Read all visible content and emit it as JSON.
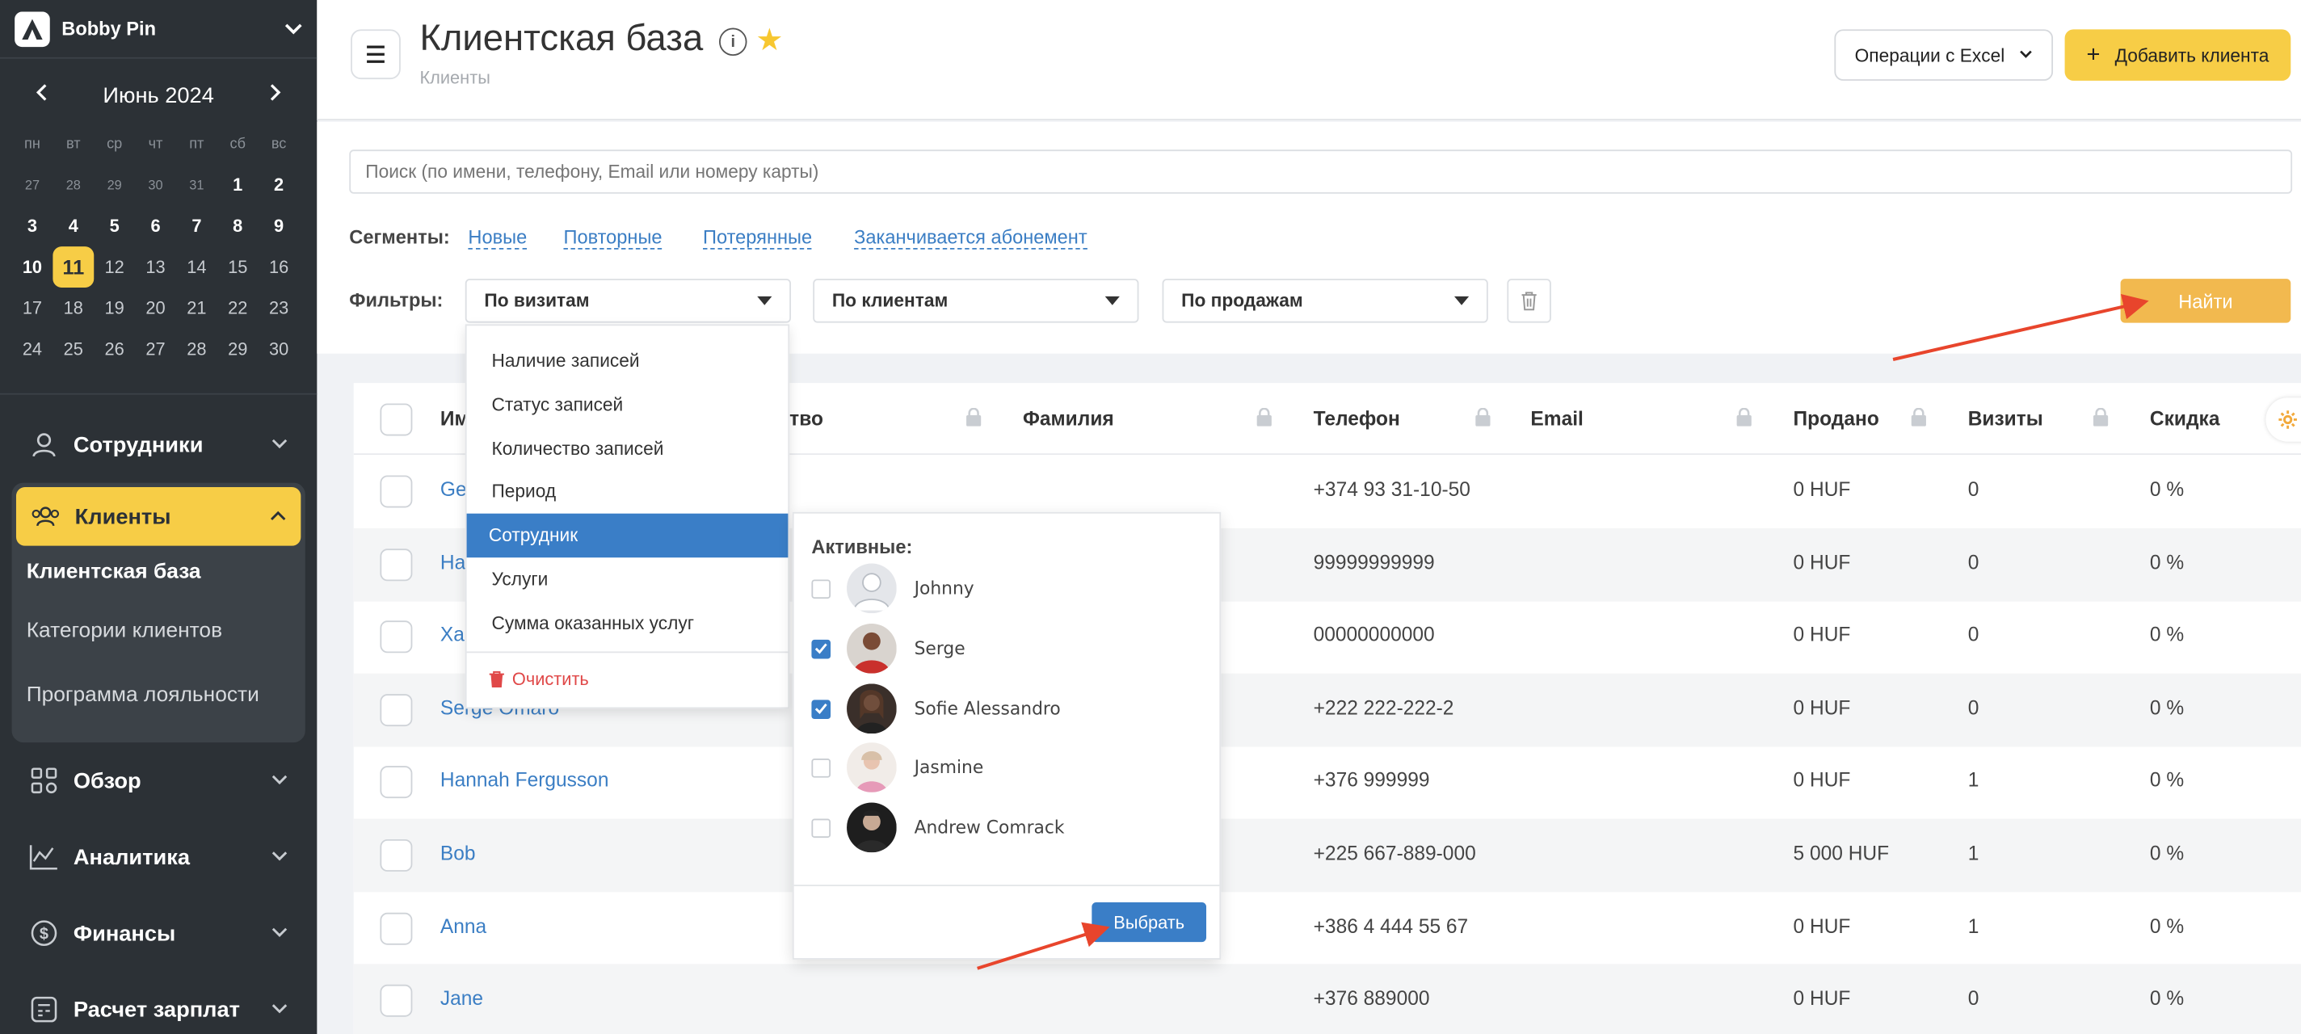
{
  "brand": {
    "name": "Bobby Pin"
  },
  "calendar": {
    "title": "Июнь 2024",
    "weekdays": [
      "пн",
      "вт",
      "ср",
      "чт",
      "пт",
      "сб",
      "вс"
    ],
    "days": [
      {
        "d": "27",
        "k": "dim"
      },
      {
        "d": "28",
        "k": "dim"
      },
      {
        "d": "29",
        "k": "dim"
      },
      {
        "d": "30",
        "k": "dim"
      },
      {
        "d": "31",
        "k": "dim"
      },
      {
        "d": "1",
        "k": "bold"
      },
      {
        "d": "2",
        "k": "bold"
      },
      {
        "d": "3",
        "k": "bold"
      },
      {
        "d": "4",
        "k": "bold"
      },
      {
        "d": "5",
        "k": "bold"
      },
      {
        "d": "6",
        "k": "bold"
      },
      {
        "d": "7",
        "k": "bold"
      },
      {
        "d": "8",
        "k": "bold"
      },
      {
        "d": "9",
        "k": "bold"
      },
      {
        "d": "10",
        "k": "bold"
      },
      {
        "d": "11",
        "k": "today"
      },
      {
        "d": "12",
        "k": "reg"
      },
      {
        "d": "13",
        "k": "reg"
      },
      {
        "d": "14",
        "k": "reg"
      },
      {
        "d": "15",
        "k": "reg"
      },
      {
        "d": "16",
        "k": "reg"
      },
      {
        "d": "17",
        "k": "reg"
      },
      {
        "d": "18",
        "k": "reg"
      },
      {
        "d": "19",
        "k": "reg"
      },
      {
        "d": "20",
        "k": "reg"
      },
      {
        "d": "21",
        "k": "reg"
      },
      {
        "d": "22",
        "k": "reg"
      },
      {
        "d": "23",
        "k": "reg"
      },
      {
        "d": "24",
        "k": "reg"
      },
      {
        "d": "25",
        "k": "reg"
      },
      {
        "d": "26",
        "k": "reg"
      },
      {
        "d": "27",
        "k": "reg"
      },
      {
        "d": "28",
        "k": "reg"
      },
      {
        "d": "29",
        "k": "reg"
      },
      {
        "d": "30",
        "k": "reg"
      }
    ]
  },
  "nav": {
    "staff": "Сотрудники",
    "clients": "Клиенты",
    "clients_sub": [
      "Клиентская база",
      "Категории клиентов",
      "Программа лояльности"
    ],
    "overview": "Обзор",
    "analytics": "Аналитика",
    "finance": "Финансы",
    "payroll": "Расчет зарплат"
  },
  "header": {
    "title": "Клиентская база",
    "breadcrumb": "Клиенты",
    "excel_label": "Операции с Excel",
    "add_label": "Добавить клиента"
  },
  "search": {
    "placeholder": "Поиск (по имени, телефону, Email или номеру карты)"
  },
  "segments": {
    "label": "Сегменты:",
    "items": [
      "Новые",
      "Повторные",
      "Потерянные",
      "Заканчивается абонемент"
    ]
  },
  "filters": {
    "label": "Фильтры:",
    "selects": [
      "По визитам",
      "По клиентам",
      "По продажам"
    ],
    "find_label": "Найти"
  },
  "dropdown": {
    "items": [
      "Наличие записей",
      "Статус записей",
      "Количество записей",
      "Период",
      "Сотрудник",
      "Услуги",
      "Сумма оказанных услуг"
    ],
    "selected_index": 4,
    "clear_label": "Очистить"
  },
  "employees": {
    "title": "Активные:",
    "items": [
      {
        "name": "Johnny",
        "checked": false
      },
      {
        "name": "Serge",
        "checked": true
      },
      {
        "name": "Sofie Alessandro",
        "checked": true
      },
      {
        "name": "Jasmine",
        "checked": false
      },
      {
        "name": "Andrew Comrack",
        "checked": false
      }
    ],
    "choose_label": "Выбрать"
  },
  "table": {
    "columns": {
      "name": "Им",
      "middlename": "тво",
      "surname": "Фамилия",
      "phone": "Телефон",
      "email": "Email",
      "sold": "Продано",
      "visits": "Визиты",
      "discount": "Скидка"
    },
    "rows": [
      {
        "name": "Ge",
        "phone": "+374 93 31-10-50",
        "sold": "0 HUF",
        "visits": "0",
        "discount": "0 %"
      },
      {
        "name": "Ha",
        "phone": "99999999999",
        "sold": "0 HUF",
        "visits": "0",
        "discount": "0 %"
      },
      {
        "name": "Xa",
        "phone": "00000000000",
        "sold": "0 HUF",
        "visits": "0",
        "discount": "0 %"
      },
      {
        "name": "Serge Omaro",
        "phone": "+222 222-222-2",
        "sold": "0 HUF",
        "visits": "0",
        "discount": "0 %"
      },
      {
        "name": "Hannah Fergusson",
        "phone": "+376 999999",
        "sold": "0 HUF",
        "visits": "1",
        "discount": "0 %"
      },
      {
        "name": "Bob",
        "phone": "+225 667-889-000",
        "sold": "5 000 HUF",
        "visits": "1",
        "discount": "0 %"
      },
      {
        "name": "Anna",
        "phone": "+386 4 444 55 67",
        "sold": "0 HUF",
        "visits": "1",
        "discount": "0 %"
      },
      {
        "name": "Jane",
        "phone": "+376 889000",
        "sold": "0 HUF",
        "visits": "0",
        "discount": "0 %"
      }
    ]
  },
  "colors": {
    "accent": "#f7cd46",
    "link": "#3b7ec4",
    "selected": "#3a7ec7",
    "find": "#f2b94f",
    "annotation_arrow": "#e8452c"
  }
}
